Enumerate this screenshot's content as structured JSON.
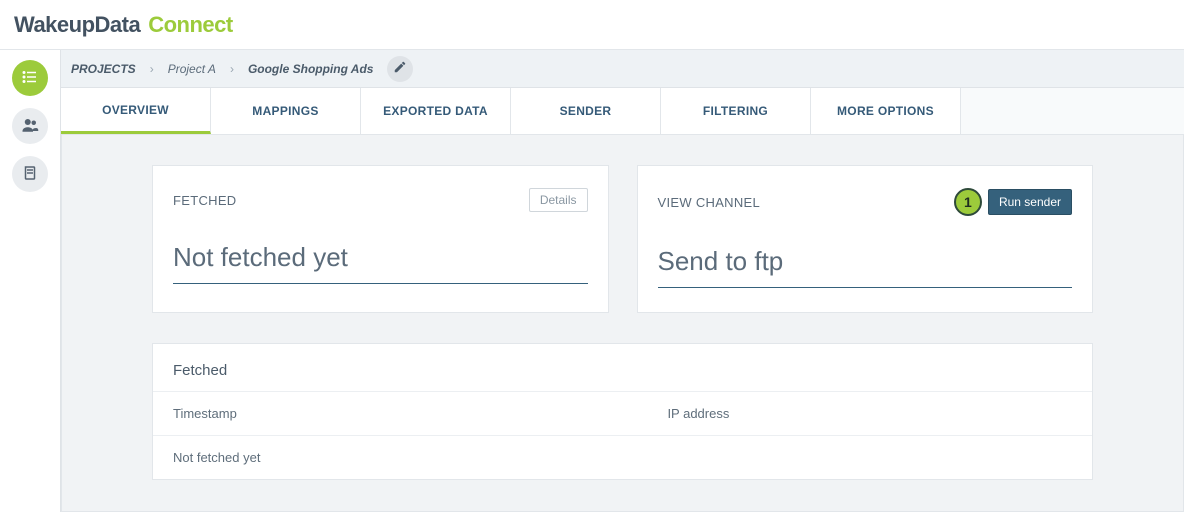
{
  "brand": {
    "primary": "WakeupData",
    "secondary": "Connect"
  },
  "breadcrumbs": {
    "root": "PROJECTS",
    "project": "Project A",
    "current": "Google Shopping Ads"
  },
  "tabs": [
    {
      "label": "OVERVIEW",
      "active": true
    },
    {
      "label": "MAPPINGS"
    },
    {
      "label": "EXPORTED DATA"
    },
    {
      "label": "SENDER"
    },
    {
      "label": "FILTERING"
    },
    {
      "label": "MORE OPTIONS"
    }
  ],
  "fetched_card": {
    "title": "FETCHED",
    "details_label": "Details",
    "value": "Not fetched yet"
  },
  "channel_card": {
    "title": "VIEW CHANNEL",
    "step": "1",
    "run_label": "Run sender",
    "value": "Send to ftp"
  },
  "fetched_table": {
    "title": "Fetched",
    "col_timestamp": "Timestamp",
    "col_ip": "IP address",
    "empty_row": "Not fetched yet"
  }
}
